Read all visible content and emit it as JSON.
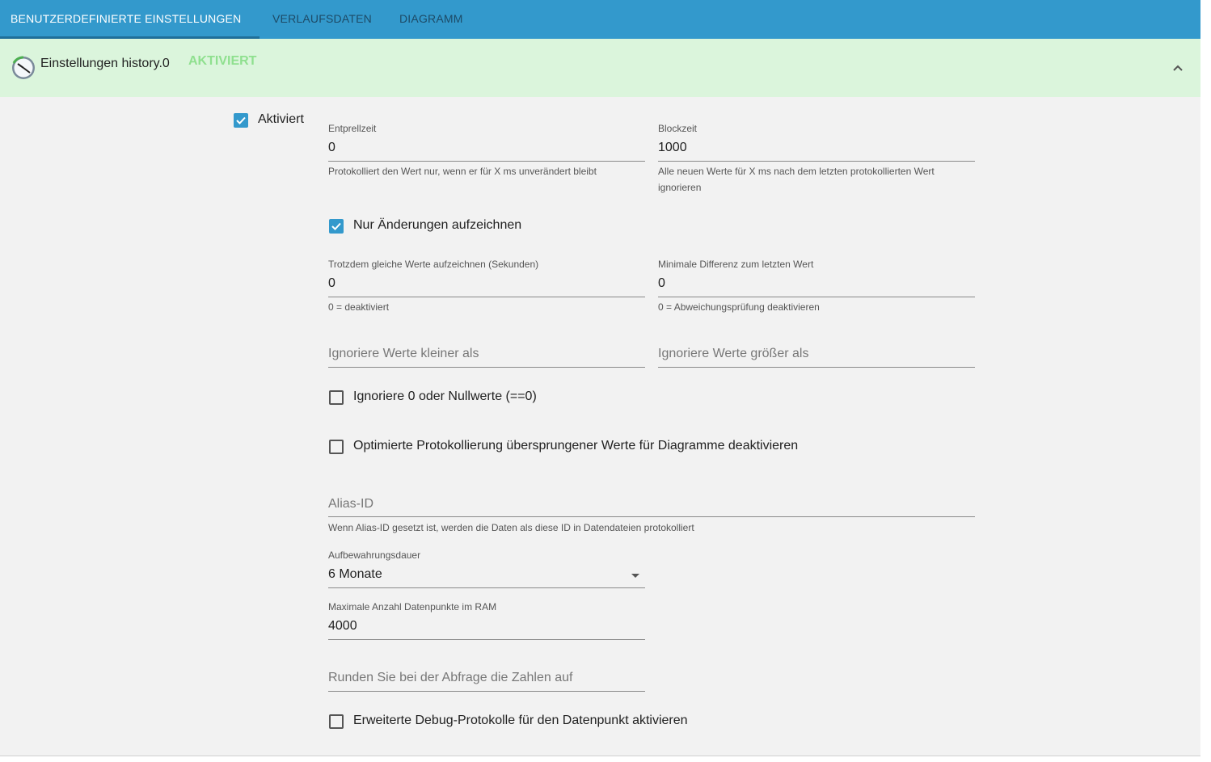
{
  "tabs": [
    {
      "label": "BENUTZERDEFINIERTE EINSTELLUNGEN"
    },
    {
      "label": "VERLAUFSDATEN"
    },
    {
      "label": "DIAGRAMM"
    }
  ],
  "header": {
    "title": "Einstellungen history.0",
    "status": "AKTIVIERT",
    "logo_icon": "history-adapter-icon",
    "collapse_icon": "chevron-up-icon"
  },
  "colors": {
    "tab_bar": "#3399cc",
    "header_bg": "#dbf5dc",
    "status_green": "#8fe08f",
    "checkbox_checked": "#3399cc"
  },
  "form": {
    "enabled": {
      "label": "Aktiviert",
      "checked": true
    },
    "debounce": {
      "label": "Entprellzeit",
      "value": "0",
      "help": "Protokolliert den Wert nur, wenn er für X ms unverändert bleibt"
    },
    "blocktime": {
      "label": "Blockzeit",
      "value": "1000",
      "help": "Alle neuen Werte für X ms nach dem letzten protokollierten Wert ignorieren"
    },
    "changes_only": {
      "label": "Nur Änderungen aufzeichnen",
      "checked": true
    },
    "changes_relog": {
      "label": "Trotzdem gleiche Werte aufzeichnen (Sekunden)",
      "value": "0",
      "help": "0 = deaktiviert"
    },
    "min_diff": {
      "label": "Minimale Differenz zum letzten Wert",
      "value": "0",
      "help": "0 = Abweichungsprüfung deaktivieren"
    },
    "ignore_below": {
      "placeholder": "Ignoriere Werte kleiner als"
    },
    "ignore_above": {
      "placeholder": "Ignoriere Werte größer als"
    },
    "ignore_zero": {
      "label": "Ignoriere 0 oder Nullwerte (==0)",
      "checked": false
    },
    "disable_skipped": {
      "label": "Optimierte Protokollierung übersprungener Werte für Diagramme deaktivieren",
      "checked": false
    },
    "alias": {
      "placeholder": "Alias-ID",
      "help": "Wenn Alias-ID gesetzt ist, werden die Daten als diese ID in Datendateien protokolliert"
    },
    "retention": {
      "label": "Aufbewahrungsdauer",
      "value": "6 Monate"
    },
    "max_length": {
      "label": "Maximale Anzahl Datenpunkte im RAM",
      "value": "4000"
    },
    "round": {
      "placeholder": "Runden Sie bei der Abfrage die Zahlen auf"
    },
    "debug": {
      "label": "Erweiterte Debug-Protokolle für den Datenpunkt aktivieren",
      "checked": false
    }
  }
}
